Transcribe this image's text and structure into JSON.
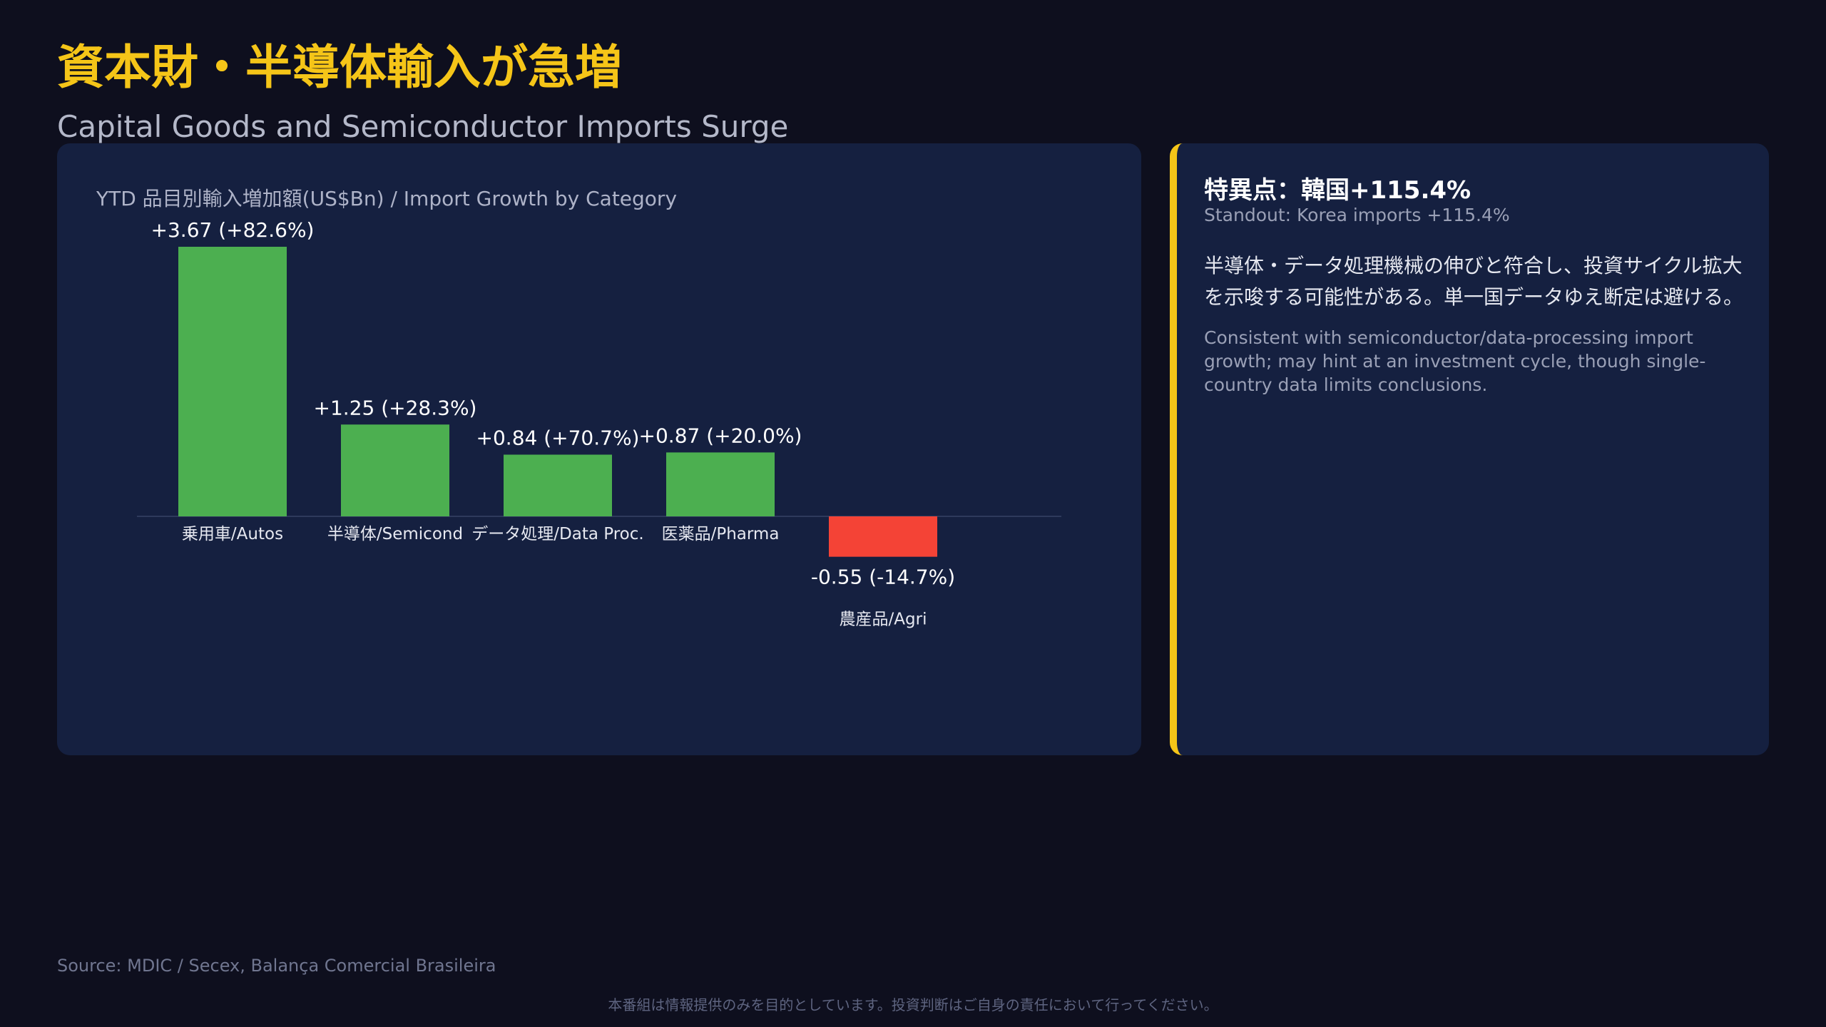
{
  "header": {
    "title": "資本財・半導体輸入が急増",
    "subtitle": "Capital Goods and Semiconductor Imports Surge"
  },
  "chart": {
    "title": "YTD 品目別輸入増加額(US$Bn) / Import Growth by Category"
  },
  "chart_data": {
    "type": "bar",
    "title": "YTD 品目別輸入増加額(US$Bn) / Import Growth by Category",
    "categories": [
      "乗用車/Autos",
      "半導体/Semicond",
      "データ処理/Data Proc.",
      "医薬品/Pharma",
      "農産品/Agri"
    ],
    "values": [
      3.67,
      1.25,
      0.84,
      0.87,
      -0.55
    ],
    "value_labels": [
      "+3.67 (+82.6%)",
      "+1.25 (+28.3%)",
      "+0.84 (+70.7%)",
      "+0.87 (+20.0%)",
      "-0.55 (-14.7%)"
    ],
    "positive_color": "#4caf50",
    "negative_color": "#f44336",
    "ylim": [
      -0.6,
      3.8
    ],
    "grid": false,
    "xlabel": "",
    "ylabel": ""
  },
  "side": {
    "heading": "特異点：韓国+115.4%",
    "subheading": "Standout: Korea imports +115.4%",
    "body_ja": "半導体・データ処理機械の伸びと符合し、投資サイクル拡大を示唆する可能性がある。単一国データゆえ断定は避ける。",
    "body_en": "Consistent with semiconductor/data-processing import growth; may hint at an investment cycle, though single-country data limits conclusions.",
    "accent_color": "#f5c518"
  },
  "footer": {
    "source": "Source: MDIC / Secex, Balança Comercial Brasileira",
    "disclaimer": "本番組は情報提供のみを目的としています。投資判断はご自身の責任において行ってください。"
  }
}
